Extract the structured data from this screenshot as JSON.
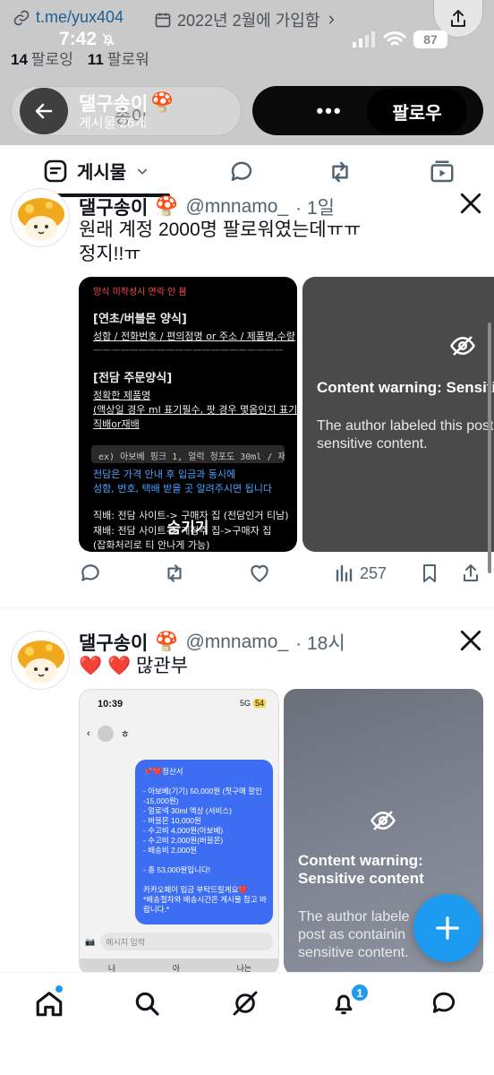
{
  "status_bar": {
    "time": "7:42",
    "battery": "87"
  },
  "profile": {
    "link": "t.me/yux404",
    "joined": "2022년 2월에 가입함",
    "following_count": "14",
    "following_label": "팔로잉",
    "followers_count": "11",
    "followers_label": "팔로워"
  },
  "header": {
    "name": "댈구송이",
    "posts_count": "게시물 26개",
    "ghost_text": "송이",
    "more_label": "•••",
    "follow_label": "팔로우"
  },
  "tabs": {
    "posts_label": "게시물"
  },
  "tweet1": {
    "name": "댈구송이",
    "handle": "@mnnamo_",
    "time": "· 1일",
    "text_line1": "원래 계정 2000명 팔로워였는데ㅠㅠ",
    "text_line2": "정지!!ㅠ",
    "media_left": {
      "red_note": "양식 미작성시 연락 안 봄",
      "section1_title": "[연초/버블몬 양식]",
      "section1_line": "성함 / 전화번호 / 편의점명 or 주소 / 제품명,수량",
      "dashes": "ㅡㅡㅡㅡㅡㅡㅡㅡㅡㅡㅡㅡㅡㅡㅡㅡㅡㅡㅡㅡㅡ",
      "section2_title": "[전담 주문양식]",
      "section2_line1": "정확한 제품명",
      "section2_line2": "(액상일 경우 ml 표기필수, 팟 경우 몇옴인지 표기)",
      "section2_line3": "직배or재배",
      "code_example": "ex) 아보베 핑크 1, 얼럭 청포도 30ml / 재배",
      "blue_line1": "전담은 가격 안내 후 입금과 동시에",
      "blue_line2": "성함, 번호, 택배 받을 곳 알려주시면 됩니다",
      "line_direct": "직배: 전담 사이트-> 구매자 집 (전담인거 티남)",
      "line_rebae": "재배: 전담 사이트-> 계정주 집->구매자 집",
      "line_note": "(잡화처리로 티 안나게 가능)",
      "hide_label": "숨기기"
    },
    "media_right": {
      "cw_title": "Content warning: Sensitive",
      "cw_body1": "The author labeled this post",
      "cw_body2": "sensitive content."
    },
    "view_count": "257"
  },
  "tweet2": {
    "name": "댈구송이",
    "handle": "@mnnamo_",
    "time": "· 18시",
    "text": "❤️ ❤️ 많관부",
    "media_left": {
      "phone_time": "10:39",
      "phone_signal": "5G",
      "phone_battery": "54",
      "chat_title": "ㅎ",
      "bubble_lines": [
        "📌❤️정산서",
        "",
        "- 아보베(기기) 50,000원 (첫구매 할인",
        "-15,000원)",
        "- 얼로넥 30ml 액상 (서비스)",
        "- 버블몬 10,000원",
        "- 수고비 4,000원(아보베)",
        "- 수고비 2,000원(버블몬)",
        "- 배송비 2,000원",
        "",
        "- 총 53,000원입니다!",
        "",
        "카카오페이 입금 부탁드릴게요❤️",
        "*배송절차와 배송시간은 게시물 참고 바",
        "랍니다.*"
      ],
      "input_placeholder": "메시지 입력",
      "kb_keys": [
        "나",
        "아",
        "나는"
      ]
    },
    "media_right": {
      "cw_title1": "Content warning:",
      "cw_title2": "Sensitive content",
      "cw_body1": "The author labele",
      "cw_body2": "post as containin",
      "cw_body3": "sensitive content."
    }
  },
  "bottom_nav": {
    "notification_badge": "1"
  },
  "colors": {
    "accent": "#1d9bf0",
    "text": "#0f1419",
    "muted": "#536471"
  }
}
